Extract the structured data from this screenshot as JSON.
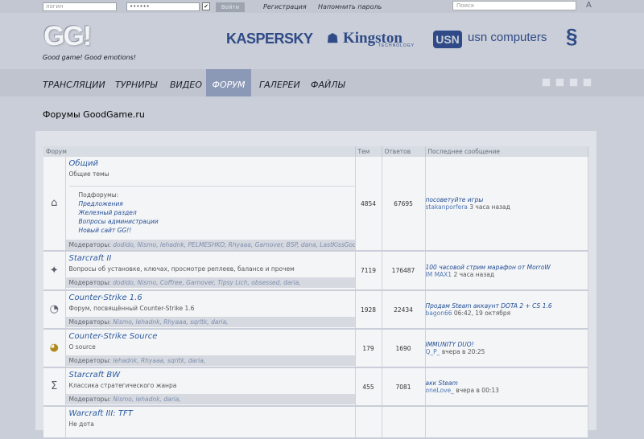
{
  "topbar": {
    "login_placeholder": "логин",
    "password_value": "••••••",
    "remember_mark": "✔",
    "login_button": "Войти",
    "register_link": "Регистрация",
    "remind_link": "Напомнить пароль",
    "search_placeholder": "Поиск",
    "lang_icon": "A"
  },
  "header": {
    "logo": "GG!",
    "slogan": "Good game! Good emotions!",
    "sponsors": {
      "kaspersky": "KASPERSKY",
      "kingston": "Kingston",
      "kingston_sub": "TECHNOLOGY",
      "usn_badge": "USN",
      "usn": "usn computers",
      "razer": "§"
    }
  },
  "nav": {
    "items": [
      "ТРАНСЛЯЦИИ",
      "ТУРНИРЫ",
      "ВИДЕО",
      "ФОРУМ",
      "ГАЛЕРЕИ",
      "ФАЙЛЫ"
    ],
    "active": "ФОРУМ"
  },
  "page": {
    "title": "Форумы GoodGame.ru"
  },
  "forum_table": {
    "headers": {
      "forum": "Форум",
      "topics": "Тем",
      "replies": "Ответов",
      "last": "Последнее сообщение"
    },
    "mods_label": "Модераторы:",
    "rows": [
      {
        "icon": "⌂",
        "name": "Общий",
        "desc": "Общие темы",
        "subforums_label": "Подфорумы:",
        "subforums": [
          "Предложения",
          "Железный раздел",
          "Вопросы администрации",
          "Новый сайт GG!!"
        ],
        "mods": "dodido, Nismo, lehadnk, PELMESHKO, Rhyaaa, Garnover, BSP, dana, LastKissGod,",
        "topics": "4854",
        "replies": "67695",
        "last_topic": "посоветуйте игры",
        "last_user": "stakanporfera",
        "last_time": "3 часа назад"
      },
      {
        "icon": "✦",
        "name": "Starcraft II",
        "desc": "Вопросы об установке, ключах, просмотре реплеев, балансе и прочем",
        "mods": "dodido, Nismo, Coffree, Garnover, Tipsy Lich, obsessed, daria,",
        "topics": "7119",
        "replies": "176487",
        "last_topic": "100 часовой стрим марафон от MorroW",
        "last_user": "IM MAX1",
        "last_time": "2 часа назад"
      },
      {
        "icon": "◔",
        "name": "Counter-Strike 1.6",
        "desc": "Форум, посвящённый Counter-Strike 1.6",
        "mods": "Nismo, lehadnk, Rhyaaa, sqrltk, daria,",
        "topics": "1928",
        "replies": "22434",
        "last_topic": "Продам Steam аккаунт DOTA 2 + CS 1.6",
        "last_user": "bagon66",
        "last_time": "06:42, 19 октября"
      },
      {
        "icon": "◕",
        "name": "Counter-Strike Source",
        "desc": "O source",
        "mods": "lehadnk, Rhyaaa, sqrltk, daria,",
        "topics": "179",
        "replies": "1690",
        "last_topic": "IMMUNITY DUO!",
        "last_user": "Q_P_",
        "last_time": "вчера в 20:25"
      },
      {
        "icon": "Σ",
        "name": "Starcraft BW",
        "desc": "Классика стратегического жанра",
        "mods": "Nismo, lehadnk, daria,",
        "topics": "455",
        "replies": "7081",
        "last_topic": "акк Steam",
        "last_user": "oneLove_",
        "last_time": "вчера в 00:13"
      },
      {
        "icon": "",
        "name": "Warcraft III: TFT",
        "desc": "Не дота",
        "topics": "",
        "replies": "",
        "last_topic": "",
        "last_user": "",
        "last_time": ""
      }
    ]
  },
  "colors": {
    "nav_active": "#8b99b7",
    "link": "#2b5a9e",
    "header_bg": "#c9ced8"
  }
}
